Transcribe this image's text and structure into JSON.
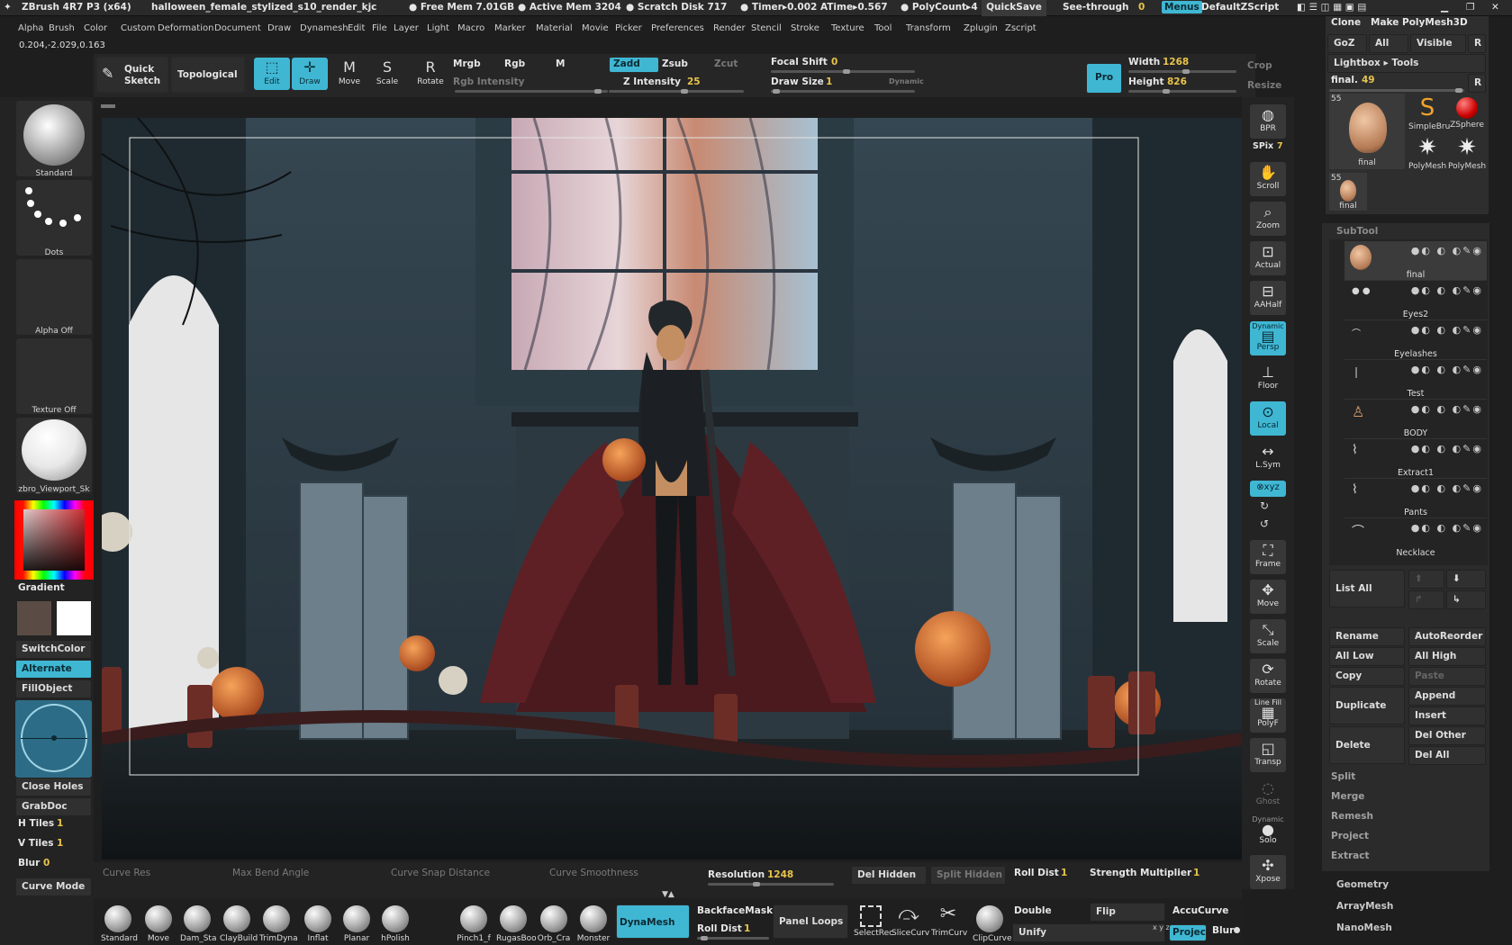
{
  "titlebar": {
    "app": "ZBrush 4R7 P3 (x64)",
    "doc": "halloween_female_stylized_s10_render_kjc",
    "free_mem": "● Free Mem 7.01GB",
    "active_mem": "● Active Mem 3204",
    "scratch": "● Scratch Disk 717",
    "timer": "● Timer▸0.002 ATime▸0.567",
    "poly": "● PolyCount▸4",
    "quicksave": "QuickSave",
    "seethrough": "See-through",
    "seethrough_val": "0",
    "menus": "Menus",
    "script": "DefaultZScript"
  },
  "menubar": [
    "Alpha",
    "Brush",
    "Color",
    "Custom",
    "Deformation",
    "Document",
    "Draw",
    "Dynamesh",
    "Edit",
    "File",
    "Layer",
    "Light",
    "Macro",
    "Marker",
    "Material",
    "Movie",
    "Picker",
    "Preferences",
    "Render",
    "Stencil",
    "Stroke",
    "Texture",
    "Tool",
    "Transform",
    "Zplugin",
    "Zscript"
  ],
  "coords": "0.204,-2.029,0.163",
  "toolbar": {
    "quicksketch1": "Quick",
    "quicksketch2": "Sketch",
    "topological": "Topological",
    "edit": "Edit",
    "draw": "Draw",
    "move": "Move",
    "scale": "Scale",
    "rotate": "Rotate",
    "mrgb": "Mrgb",
    "rgb": "Rgb",
    "m": "M",
    "rgb_int": "Rgb Intensity",
    "zadd": "Zadd",
    "zsub": "Zsub",
    "zcut": "Zcut",
    "zint_label": "Z Intensity",
    "zint_val": "25",
    "focal_label": "Focal Shift",
    "focal_val": "0",
    "drawsize_label": "Draw Size",
    "drawsize_val": "1",
    "dynamic": "Dynamic",
    "pro": "Pro",
    "width_label": "Width",
    "width_val": "1268",
    "height_label": "Height",
    "height_val": "826",
    "crop": "Crop",
    "resize": "Resize"
  },
  "left": {
    "standard": "Standard",
    "dots": "Dots",
    "alpha_off": "Alpha Off",
    "texture_off": "Texture Off",
    "material": "zbro_Viewport_Sk",
    "gradient": "Gradient",
    "switchcolor": "SwitchColor",
    "alternate": "Alternate",
    "fillobject": "FillObject",
    "closeholes": "Close Holes",
    "grabdoc": "GrabDoc",
    "htiles": "H Tiles",
    "htiles_val": "1",
    "vtiles": "V Tiles",
    "vtiles_val": "1",
    "blur": "Blur",
    "blur_val": "0",
    "curvemode": "Curve Mode"
  },
  "righttools": {
    "bpr": "BPR",
    "spix": "SPix",
    "spix_val": "7",
    "scroll": "Scroll",
    "zoom": "Zoom",
    "actual": "Actual",
    "aahalf": "AAHalf",
    "dynamic": "Dynamic",
    "persp": "Persp",
    "floor": "Floor",
    "local": "Local",
    "lsym": "L.Sym",
    "xyz": "⊗xyz",
    "frame": "Frame",
    "move": "Move",
    "scale": "Scale",
    "rotate": "Rotate",
    "linefill": "Line Fill",
    "polyf": "PolyF",
    "transp": "Transp",
    "ghost": "Ghost",
    "dynamic2": "Dynamic",
    "solo": "Solo",
    "xpose": "Xpose"
  },
  "toolpanel": {
    "clone": "Clone",
    "make": "Make PolyMesh3D",
    "goz": "GoZ",
    "all": "All",
    "visible": "Visible",
    "r": "R",
    "lightbox": "Lightbox ▸ Tools",
    "final_label": "final.",
    "final_val": "49",
    "count1": "55",
    "count2": "55",
    "thumb_final": "final",
    "simplebr": "SimpleBru",
    "zsphere": "ZSphere",
    "polymesh1": "PolyMesh",
    "polymesh2": "PolyMesh",
    "thumb_final2": "final"
  },
  "subtool": {
    "header": "SubTool",
    "items": [
      "final",
      "Eyes2",
      "Eyelashes",
      "Test",
      "BODY",
      "Extract1",
      "Pants",
      "Necklace"
    ],
    "listall": "List All",
    "rename": "Rename",
    "autoreorder": "AutoReorder",
    "alllow": "All Low",
    "allhigh": "All High",
    "copy": "Copy",
    "paste": "Paste",
    "duplicate": "Duplicate",
    "append": "Append",
    "insert": "Insert",
    "delete": "Delete",
    "delother": "Del Other",
    "delall": "Del All",
    "split": "Split",
    "merge": "Merge",
    "remesh": "Remesh",
    "project": "Project",
    "extract": "Extract",
    "geometry": "Geometry",
    "arraymesh": "ArrayMesh",
    "nanomesh": "NanoMesh"
  },
  "bottom": {
    "curveres": "Curve Res",
    "maxbend": "Max Bend Angle",
    "snapdist": "Curve Snap Distance",
    "smooth": "Curve Smoothness",
    "resolution": "Resolution",
    "resolution_val": "1248",
    "delhidden": "Del Hidden",
    "splithidden": "Split Hidden",
    "rolldist": "Roll Dist",
    "rolldist_val": "1",
    "strength": "Strength Multiplier",
    "strength_val": "1",
    "brushes": [
      "Standard",
      "Move",
      "Dam_Sta",
      "ClayBuild",
      "TrimDyna",
      "Inflat",
      "Planar",
      "hPolish",
      "Pinch1_f",
      "RugasBoo",
      "Orb_Cra",
      "Monster"
    ],
    "dynamesh": "DynaMesh",
    "backface": "BackfaceMask",
    "rolldist2": "Roll Dist",
    "rolldist2_val": "1",
    "panelloops": "Panel Loops",
    "tools2": [
      "SelectRec",
      "SliceCurv",
      "TrimCurv",
      "ClipCurve"
    ],
    "double": "Double",
    "flip": "Flip",
    "accucurve": "AccuCurve",
    "unify": "Unify",
    "project": "Projec",
    "blur": "Blur"
  },
  "colors": {
    "accent": "#3fb7d3",
    "value": "#e9c44b"
  }
}
